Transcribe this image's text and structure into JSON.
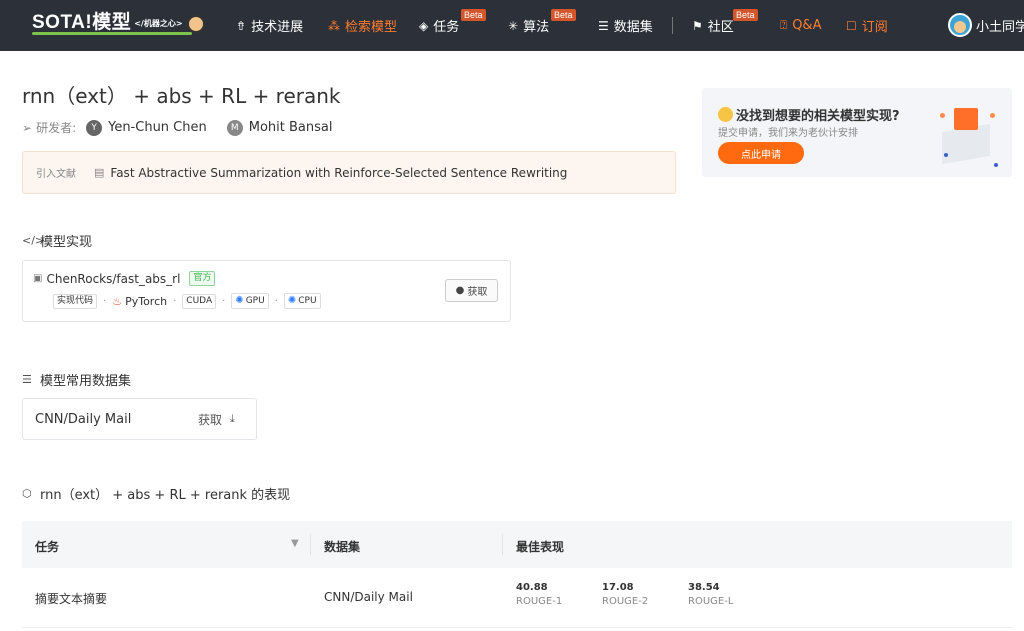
{
  "nav": {
    "logo": "SOTA!模型",
    "logo_tagline": "</机器之心>",
    "items": [
      {
        "label": "技术进展",
        "icon": "rocket-icon",
        "badge": ""
      },
      {
        "label": "检索模型",
        "icon": "nodes-icon",
        "badge": ""
      },
      {
        "label": "任务",
        "icon": "layers-icon",
        "badge": "Beta"
      },
      {
        "label": "算法",
        "icon": "atom-icon",
        "badge": "Beta"
      },
      {
        "label": "数据集",
        "icon": "database-icon",
        "badge": ""
      },
      {
        "label": "社区",
        "icon": "flag-icon",
        "badge": "Beta"
      },
      {
        "label": "Q&A",
        "icon": "question-icon",
        "badge": ""
      },
      {
        "label": "订阅",
        "icon": "bookmark-icon",
        "badge": ""
      }
    ],
    "username": "小土同学"
  },
  "page": {
    "title": "rnn（ext） + abs + RL + rerank",
    "authors_label": "研发者:",
    "authors": [
      {
        "initial": "Y",
        "name": "Yen-Chun Chen"
      },
      {
        "initial": "M",
        "name": "Mohit Bansal"
      }
    ],
    "citation_label": "引入文献",
    "citation": "Fast Abstractive Summarization with Reinforce-Selected Sentence Rewriting"
  },
  "promo": {
    "title": "没找到想要的相关模型实现?",
    "subtitle": "提交申请，我们来为老伙计安排",
    "button": "点此申请"
  },
  "implementation": {
    "section_title": "模型实现",
    "repo": "ChenRocks/fast_abs_rl",
    "official_badge": "官方",
    "tags": {
      "code": "实现代码",
      "framework": "PyTorch",
      "cuda": "CUDA",
      "gpu": "GPU",
      "cpu": "CPU"
    },
    "get_button": "获取"
  },
  "datasets": {
    "section_title": "模型常用数据集",
    "items": [
      {
        "name": "CNN/Daily Mail",
        "action": "获取"
      }
    ]
  },
  "performance": {
    "section_title": "rnn（ext） + abs + RL + rerank 的表现",
    "headers": {
      "task": "任务",
      "dataset": "数据集",
      "best": "最佳表现"
    },
    "rows": [
      {
        "task": "摘要文本摘要",
        "dataset": "CNN/Daily Mail",
        "metrics": [
          {
            "value": "40.88",
            "name": "ROUGE-1"
          },
          {
            "value": "17.08",
            "name": "ROUGE-2"
          },
          {
            "value": "38.54",
            "name": "ROUGE-L"
          }
        ]
      }
    ]
  },
  "colors": {
    "accent": "#ff7d2e",
    "nav_bg": "#2c3038",
    "promo_button": "#ff6a10"
  }
}
